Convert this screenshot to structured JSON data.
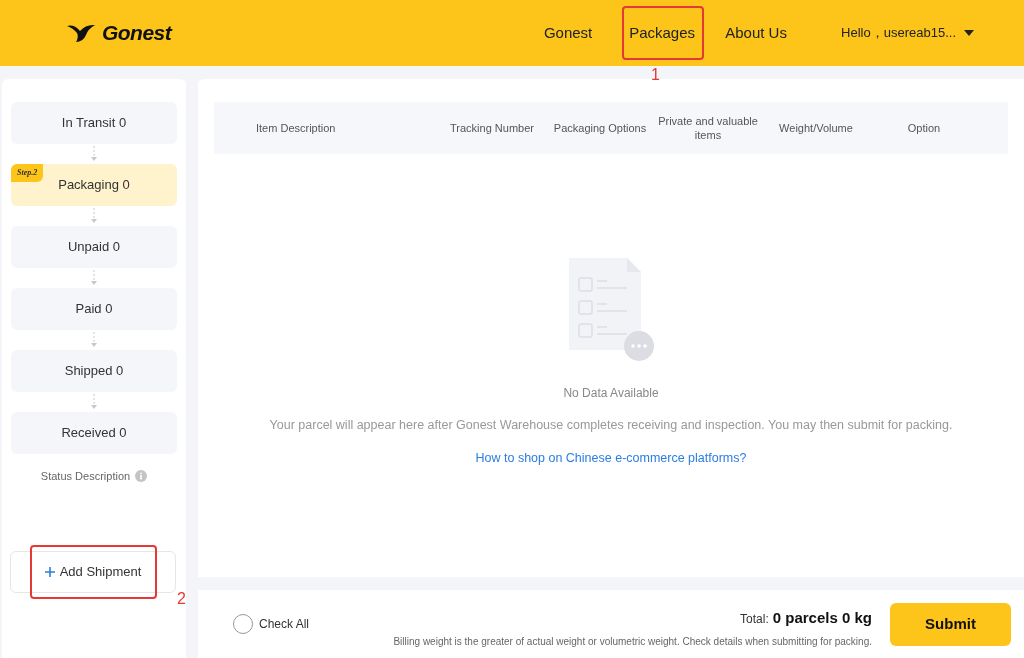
{
  "header": {
    "logo": "Gonest",
    "nav": [
      {
        "label": "Gonest"
      },
      {
        "label": "Packages",
        "annotation": "1"
      },
      {
        "label": "About Us"
      }
    ],
    "user": "Hello，usereab15..."
  },
  "steps": [
    {
      "label": "In Transit 0",
      "selected": false
    },
    {
      "label": "Packaging 0",
      "selected": true,
      "badge": "Step.2"
    },
    {
      "label": "Unpaid 0",
      "selected": false
    },
    {
      "label": "Paid 0",
      "selected": false
    },
    {
      "label": "Shipped 0",
      "selected": false
    },
    {
      "label": "Received 0",
      "selected": false
    }
  ],
  "status_description": "Status Description",
  "add_shipment": {
    "label": "Add Shipment",
    "annotation": "2"
  },
  "table": {
    "columns": [
      "Item Description",
      "Tracking Number",
      "Packaging Options",
      "Private and valuable items",
      "Weight/Volume",
      "Option"
    ]
  },
  "empty": {
    "title": "No Data Available",
    "message": "Your parcel will appear here after Gonest Warehouse completes receiving and inspection. You may then submit for packing.",
    "link": "How to shop on Chinese e-commerce platforms?"
  },
  "footer": {
    "check_all": {
      "label": "Check All",
      "checked": false
    },
    "total_label": "Total:",
    "total_value": "0 parcels 0 kg",
    "note": "Billing weight is the greater of actual weight or volumetric weight. Check details when submitting for packing.",
    "submit": "Submit"
  }
}
